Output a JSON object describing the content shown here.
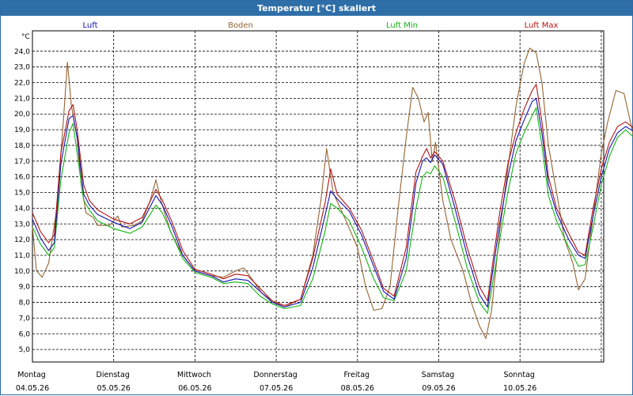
{
  "window": {
    "title": "Temperatur [°C] skaliert"
  },
  "chart_data": {
    "type": "line",
    "title": "Temperatur [°C] skaliert",
    "ylabel": "°C",
    "ylim": [
      4.2,
      25.3
    ],
    "yticks": [
      "5,0",
      "6,0",
      "7,0",
      "8,0",
      "9,0",
      "10,0",
      "11,0",
      "12,0",
      "13,0",
      "14,0",
      "15,0",
      "16,0",
      "17,0",
      "18,0",
      "19,0",
      "20,0",
      "21,0",
      "22,0",
      "23,0",
      "24,0"
    ],
    "xlim": [
      0,
      7
    ],
    "xticks": [
      {
        "day": "Montag",
        "date": "04.05.26"
      },
      {
        "day": "Dienstag",
        "date": "05.05.26"
      },
      {
        "day": "Mittwoch",
        "date": "06.05.26"
      },
      {
        "day": "Donnerstag",
        "date": "07.05.26"
      },
      {
        "day": "Freitag",
        "date": "08.05.26"
      },
      {
        "day": "Samstag",
        "date": "09.05.26"
      },
      {
        "day": "Sonntag",
        "date": "10.05.26"
      }
    ],
    "grid": true,
    "legend_position": "top",
    "series": [
      {
        "name": "Luft",
        "color": "#1414b4",
        "points": [
          [
            0,
            13.3
          ],
          [
            0.1,
            12.1
          ],
          [
            0.2,
            11.3
          ],
          [
            0.27,
            11.8
          ],
          [
            0.35,
            16.8
          ],
          [
            0.45,
            19.7
          ],
          [
            0.5,
            19.9
          ],
          [
            0.55,
            18.5
          ],
          [
            0.63,
            14.9
          ],
          [
            0.7,
            14.2
          ],
          [
            0.8,
            13.6
          ],
          [
            1.0,
            13.1
          ],
          [
            1.2,
            12.7
          ],
          [
            1.35,
            13.1
          ],
          [
            1.52,
            14.8
          ],
          [
            1.6,
            14.2
          ],
          [
            1.72,
            12.8
          ],
          [
            1.85,
            11.0
          ],
          [
            2.0,
            10.0
          ],
          [
            2.2,
            9.7
          ],
          [
            2.35,
            9.3
          ],
          [
            2.5,
            9.5
          ],
          [
            2.65,
            9.4
          ],
          [
            2.8,
            8.7
          ],
          [
            2.95,
            8.0
          ],
          [
            3.1,
            7.7
          ],
          [
            3.3,
            8.0
          ],
          [
            3.45,
            10.2
          ],
          [
            3.6,
            13.5
          ],
          [
            3.67,
            15.1
          ],
          [
            3.75,
            14.6
          ],
          [
            3.9,
            13.8
          ],
          [
            4.05,
            12.3
          ],
          [
            4.2,
            10.3
          ],
          [
            4.32,
            8.7
          ],
          [
            4.45,
            8.2
          ],
          [
            4.6,
            10.8
          ],
          [
            4.72,
            15.6
          ],
          [
            4.8,
            17.0
          ],
          [
            4.85,
            17.2
          ],
          [
            4.9,
            16.9
          ],
          [
            4.95,
            17.4
          ],
          [
            5.05,
            16.8
          ],
          [
            5.2,
            14.0
          ],
          [
            5.35,
            11.0
          ],
          [
            5.5,
            8.5
          ],
          [
            5.6,
            7.7
          ],
          [
            5.65,
            9.5
          ],
          [
            5.75,
            13.0
          ],
          [
            5.85,
            16.0
          ],
          [
            5.95,
            18.3
          ],
          [
            6.05,
            19.6
          ],
          [
            6.15,
            20.8
          ],
          [
            6.2,
            21.0
          ],
          [
            6.27,
            18.8
          ],
          [
            6.35,
            15.5
          ],
          [
            6.45,
            13.7
          ],
          [
            6.6,
            12.0
          ],
          [
            6.72,
            11.0
          ],
          [
            6.8,
            10.8
          ],
          [
            6.9,
            13.5
          ],
          [
            7.0,
            16.0
          ],
          [
            7.1,
            17.8
          ],
          [
            7.2,
            18.8
          ],
          [
            7.3,
            19.2
          ],
          [
            7.4,
            18.9
          ],
          [
            7.5,
            17.5
          ],
          [
            7.6,
            16.0
          ],
          [
            7.65,
            15.0
          ],
          [
            7.7,
            13.5
          ]
        ]
      },
      {
        "name": "Boden",
        "color": "#966432",
        "points": [
          [
            0,
            12.8
          ],
          [
            0.05,
            10.0
          ],
          [
            0.12,
            9.6
          ],
          [
            0.2,
            10.5
          ],
          [
            0.3,
            14.0
          ],
          [
            0.38,
            19.5
          ],
          [
            0.43,
            23.3
          ],
          [
            0.48,
            20.5
          ],
          [
            0.55,
            18.5
          ],
          [
            0.6,
            15.5
          ],
          [
            0.66,
            13.7
          ],
          [
            0.75,
            13.4
          ],
          [
            0.8,
            12.9
          ],
          [
            0.95,
            12.9
          ],
          [
            1.05,
            13.5
          ],
          [
            1.1,
            12.8
          ],
          [
            1.25,
            12.9
          ],
          [
            1.35,
            13.2
          ],
          [
            1.45,
            14.5
          ],
          [
            1.52,
            15.8
          ],
          [
            1.58,
            14.5
          ],
          [
            1.7,
            12.5
          ],
          [
            1.85,
            11.0
          ],
          [
            2.0,
            10.0
          ],
          [
            2.2,
            9.7
          ],
          [
            2.35,
            9.6
          ],
          [
            2.5,
            10.0
          ],
          [
            2.6,
            10.2
          ],
          [
            2.7,
            9.5
          ],
          [
            2.82,
            8.6
          ],
          [
            2.95,
            8.1
          ],
          [
            3.1,
            7.7
          ],
          [
            3.3,
            8.2
          ],
          [
            3.45,
            11.0
          ],
          [
            3.55,
            14.5
          ],
          [
            3.62,
            17.8
          ],
          [
            3.7,
            15.0
          ],
          [
            3.85,
            13.3
          ],
          [
            4.0,
            11.5
          ],
          [
            4.1,
            9.0
          ],
          [
            4.2,
            7.5
          ],
          [
            4.3,
            7.6
          ],
          [
            4.4,
            9.0
          ],
          [
            4.5,
            14.0
          ],
          [
            4.6,
            18.5
          ],
          [
            4.68,
            21.7
          ],
          [
            4.75,
            21.0
          ],
          [
            4.82,
            19.5
          ],
          [
            4.87,
            20.1
          ],
          [
            4.92,
            17.0
          ],
          [
            4.96,
            18.2
          ],
          [
            5.05,
            14.5
          ],
          [
            5.15,
            12.0
          ],
          [
            5.3,
            10.0
          ],
          [
            5.4,
            8.0
          ],
          [
            5.5,
            6.5
          ],
          [
            5.58,
            5.7
          ],
          [
            5.65,
            7.5
          ],
          [
            5.75,
            12.5
          ],
          [
            5.85,
            16.5
          ],
          [
            5.95,
            20.5
          ],
          [
            6.05,
            23.2
          ],
          [
            6.12,
            24.2
          ],
          [
            6.2,
            23.9
          ],
          [
            6.27,
            22.0
          ],
          [
            6.35,
            18.0
          ],
          [
            6.45,
            15.0
          ],
          [
            6.55,
            12.0
          ],
          [
            6.65,
            10.5
          ],
          [
            6.72,
            8.8
          ],
          [
            6.8,
            9.5
          ],
          [
            6.9,
            13.5
          ],
          [
            7.0,
            17.5
          ],
          [
            7.08,
            19.5
          ],
          [
            7.18,
            21.5
          ],
          [
            7.28,
            21.3
          ],
          [
            7.38,
            19.0
          ],
          [
            7.5,
            16.0
          ],
          [
            7.6,
            14.5
          ],
          [
            7.7,
            12.5
          ]
        ]
      },
      {
        "name": "Luft Min",
        "color": "#14b414",
        "points": [
          [
            0,
            12.8
          ],
          [
            0.1,
            11.7
          ],
          [
            0.2,
            11.0
          ],
          [
            0.27,
            11.5
          ],
          [
            0.35,
            15.8
          ],
          [
            0.45,
            18.8
          ],
          [
            0.5,
            19.4
          ],
          [
            0.55,
            17.5
          ],
          [
            0.63,
            14.5
          ],
          [
            0.7,
            13.9
          ],
          [
            0.8,
            13.2
          ],
          [
            1.0,
            12.7
          ],
          [
            1.2,
            12.4
          ],
          [
            1.35,
            12.8
          ],
          [
            1.52,
            14.2
          ],
          [
            1.6,
            13.7
          ],
          [
            1.72,
            12.3
          ],
          [
            1.85,
            10.8
          ],
          [
            2.0,
            9.9
          ],
          [
            2.2,
            9.6
          ],
          [
            2.35,
            9.2
          ],
          [
            2.5,
            9.3
          ],
          [
            2.65,
            9.2
          ],
          [
            2.8,
            8.4
          ],
          [
            2.95,
            7.9
          ],
          [
            3.1,
            7.6
          ],
          [
            3.3,
            7.8
          ],
          [
            3.45,
            9.5
          ],
          [
            3.6,
            12.5
          ],
          [
            3.67,
            14.3
          ],
          [
            3.75,
            14.0
          ],
          [
            3.9,
            13.2
          ],
          [
            4.05,
            11.5
          ],
          [
            4.2,
            9.5
          ],
          [
            4.32,
            8.3
          ],
          [
            4.45,
            8.1
          ],
          [
            4.6,
            10.0
          ],
          [
            4.72,
            14.0
          ],
          [
            4.8,
            16.0
          ],
          [
            4.85,
            16.3
          ],
          [
            4.9,
            16.2
          ],
          [
            4.95,
            16.7
          ],
          [
            5.05,
            16.0
          ],
          [
            5.2,
            13.2
          ],
          [
            5.35,
            10.2
          ],
          [
            5.5,
            8.0
          ],
          [
            5.6,
            7.3
          ],
          [
            5.65,
            8.8
          ],
          [
            5.75,
            12.0
          ],
          [
            5.85,
            15.0
          ],
          [
            5.95,
            17.5
          ],
          [
            6.05,
            18.8
          ],
          [
            6.15,
            19.9
          ],
          [
            6.2,
            20.4
          ],
          [
            6.27,
            18.0
          ],
          [
            6.35,
            14.8
          ],
          [
            6.45,
            13.2
          ],
          [
            6.6,
            11.5
          ],
          [
            6.72,
            10.3
          ],
          [
            6.8,
            10.4
          ],
          [
            6.9,
            12.8
          ],
          [
            7.0,
            15.5
          ],
          [
            7.1,
            17.3
          ],
          [
            7.2,
            18.5
          ],
          [
            7.3,
            19.0
          ],
          [
            7.4,
            18.5
          ],
          [
            7.5,
            17.0
          ],
          [
            7.6,
            15.0
          ],
          [
            7.65,
            14.0
          ],
          [
            7.7,
            12.2
          ]
        ]
      },
      {
        "name": "Luft Max",
        "color": "#b41414",
        "points": [
          [
            0,
            13.7
          ],
          [
            0.1,
            12.5
          ],
          [
            0.2,
            11.8
          ],
          [
            0.27,
            12.3
          ],
          [
            0.35,
            17.5
          ],
          [
            0.45,
            20.2
          ],
          [
            0.5,
            20.6
          ],
          [
            0.55,
            19.0
          ],
          [
            0.63,
            15.5
          ],
          [
            0.7,
            14.5
          ],
          [
            0.8,
            13.9
          ],
          [
            1.0,
            13.3
          ],
          [
            1.2,
            13.0
          ],
          [
            1.35,
            13.4
          ],
          [
            1.52,
            15.2
          ],
          [
            1.6,
            14.5
          ],
          [
            1.72,
            13.1
          ],
          [
            1.85,
            11.3
          ],
          [
            2.0,
            10.1
          ],
          [
            2.2,
            9.8
          ],
          [
            2.35,
            9.5
          ],
          [
            2.5,
            9.8
          ],
          [
            2.65,
            9.7
          ],
          [
            2.8,
            8.9
          ],
          [
            2.95,
            8.1
          ],
          [
            3.1,
            7.8
          ],
          [
            3.3,
            8.2
          ],
          [
            3.45,
            10.8
          ],
          [
            3.6,
            14.3
          ],
          [
            3.67,
            16.5
          ],
          [
            3.75,
            14.9
          ],
          [
            3.9,
            14.0
          ],
          [
            4.05,
            12.6
          ],
          [
            4.2,
            10.6
          ],
          [
            4.32,
            8.9
          ],
          [
            4.45,
            8.4
          ],
          [
            4.6,
            11.5
          ],
          [
            4.72,
            16.3
          ],
          [
            4.8,
            17.3
          ],
          [
            4.85,
            17.8
          ],
          [
            4.9,
            17.2
          ],
          [
            4.95,
            17.6
          ],
          [
            5.05,
            17.0
          ],
          [
            5.2,
            14.5
          ],
          [
            5.35,
            11.5
          ],
          [
            5.5,
            9.0
          ],
          [
            5.6,
            8.1
          ],
          [
            5.65,
            10.0
          ],
          [
            5.75,
            13.7
          ],
          [
            5.85,
            16.8
          ],
          [
            5.95,
            18.8
          ],
          [
            6.05,
            20.3
          ],
          [
            6.15,
            21.5
          ],
          [
            6.2,
            21.9
          ],
          [
            6.27,
            19.5
          ],
          [
            6.35,
            16.0
          ],
          [
            6.45,
            14.0
          ],
          [
            6.6,
            12.4
          ],
          [
            6.72,
            11.2
          ],
          [
            6.8,
            11.0
          ],
          [
            6.9,
            14.0
          ],
          [
            7.0,
            16.5
          ],
          [
            7.1,
            18.2
          ],
          [
            7.2,
            19.2
          ],
          [
            7.3,
            19.5
          ],
          [
            7.4,
            19.1
          ],
          [
            7.5,
            17.8
          ],
          [
            7.6,
            16.5
          ],
          [
            7.65,
            15.5
          ],
          [
            7.7,
            13.9
          ]
        ]
      }
    ]
  }
}
